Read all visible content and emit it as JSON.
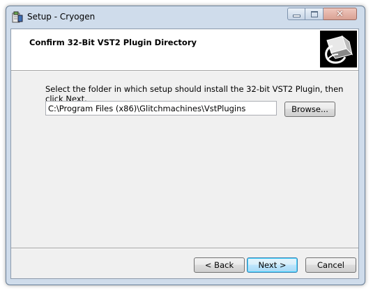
{
  "window": {
    "title": "Setup - Cryogen",
    "icon": "installer-icon",
    "controls": {
      "minimize": "minimize-icon",
      "maximize": "maximize-icon",
      "close": "close-icon"
    }
  },
  "header": {
    "title": "Confirm 32-Bit VST2 Plugin Directory",
    "logo": "installer-logo"
  },
  "body": {
    "instruction": "Select the folder in which setup should install the 32-bit VST2 Plugin, then click Next.",
    "path_value": "C:\\Program Files (x86)\\Glitchmachines\\VstPlugins",
    "browse_label": "Browse..."
  },
  "footer": {
    "back_label": "< Back",
    "next_label": "Next >",
    "cancel_label": "Cancel"
  }
}
